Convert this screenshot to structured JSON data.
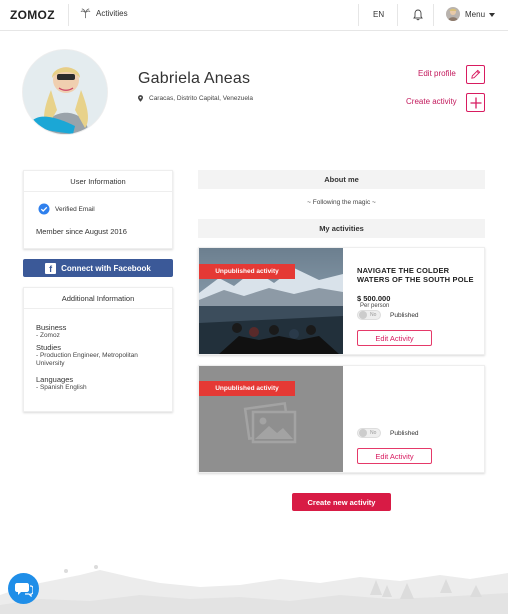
{
  "header": {
    "logo": "ZOMOZ",
    "nav_activities": "Activities",
    "language": "EN",
    "menu": "Menu"
  },
  "profile": {
    "name": "Gabriela Aneas",
    "location": "Caracas, Distrito Capital, Venezuela",
    "edit_profile": "Edit profile",
    "create_activity": "Create activity"
  },
  "user_info": {
    "title": "User Information",
    "verified_email": "Verified Email",
    "member_since": "Member since August 2016"
  },
  "facebook": {
    "label": "Connect with Facebook",
    "icon_letter": "f"
  },
  "additional_info": {
    "title": "Additional Information",
    "business_label": "Business",
    "business_value": "- Zomoz",
    "studies_label": "Studies",
    "studies_value": "- Production Engineer, Metropolitan University",
    "languages_label": "Languages",
    "languages_value": "- Spanish English"
  },
  "about": {
    "title": "About me",
    "text": "~ Following the magic ~"
  },
  "activities": {
    "title": "My activities",
    "items": [
      {
        "badge": "Unpublished activity",
        "title": "NAVIGATE THE COLDER WATERS OF THE SOUTH POLE",
        "price": "$ 500.000",
        "per_person": "Per person",
        "toggle": "No",
        "published": "Published",
        "edit": "Edit Activity",
        "image": "glacier-boat-photo"
      },
      {
        "badge": "Unpublished activity",
        "title": "",
        "price": "",
        "per_person": "",
        "toggle": "No",
        "published": "Published",
        "edit": "Edit Activity",
        "image": "image-placeholder-icon"
      }
    ],
    "create_new": "Create new activity"
  },
  "colors": {
    "accent": "#d81b60",
    "badge_red": "#e53935",
    "facebook_blue": "#3b5998",
    "chat_blue": "#1f8ee8"
  }
}
